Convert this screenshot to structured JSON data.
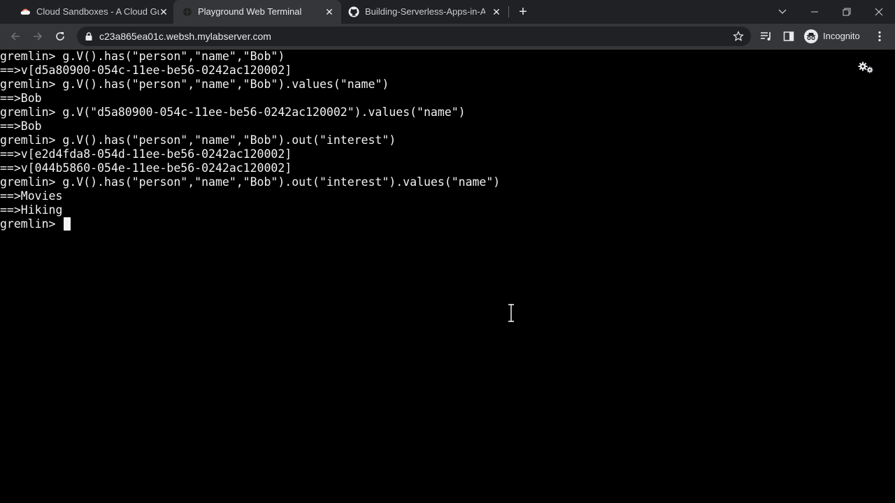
{
  "browser": {
    "tabs": [
      {
        "title": "Cloud Sandboxes - A Cloud Guru",
        "icon": "cloud-icon",
        "active": false
      },
      {
        "title": "Playground Web Terminal",
        "icon": "globe-icon",
        "active": true
      },
      {
        "title": "Building-Serverless-Apps-in-AWS",
        "icon": "github-icon",
        "active": false
      }
    ],
    "url": "c23a865ea01c.websh.mylabserver.com",
    "incognito_label": "Incognito"
  },
  "terminal": {
    "lines": [
      "gremlin> g.V().has(\"person\",\"name\",\"Bob\")",
      "==>v[d5a80900-054c-11ee-be56-0242ac120002]",
      "gremlin> g.V().has(\"person\",\"name\",\"Bob\").values(\"name\")",
      "==>Bob",
      "gremlin> g.V(\"d5a80900-054c-11ee-be56-0242ac120002\").values(\"name\")",
      "==>Bob",
      "gremlin> g.V().has(\"person\",\"name\",\"Bob\").out(\"interest\")",
      "==>v[e2d4fda8-054d-11ee-be56-0242ac120002]",
      "==>v[044b5860-054e-11ee-be56-0242ac120002]",
      "gremlin> g.V().has(\"person\",\"name\",\"Bob\").out(\"interest\").values(\"name\")",
      "==>Movies",
      "==>Hiking"
    ],
    "prompt": "gremlin> "
  },
  "colors": {
    "tabstrip_bg": "#202124",
    "toolbar_bg": "#35363a",
    "terminal_bg": "#000000",
    "terminal_fg": "#f2f2f2"
  }
}
